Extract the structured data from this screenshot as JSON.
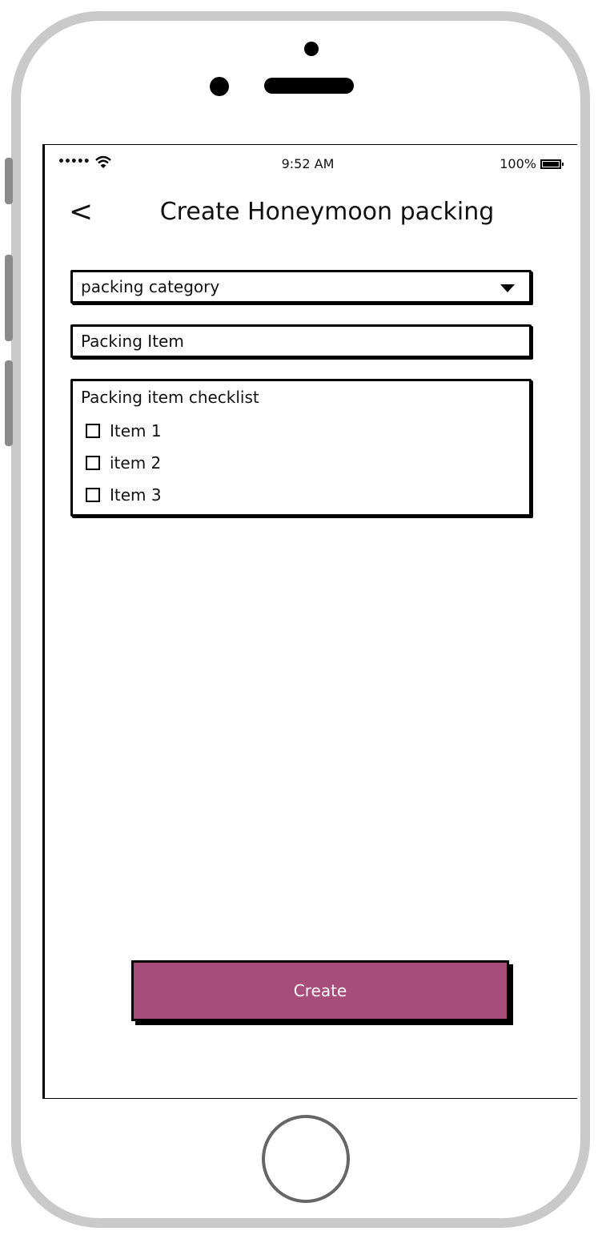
{
  "status_bar": {
    "signal": "•••••",
    "time": "9:52 AM",
    "battery": "100%"
  },
  "nav": {
    "back_glyph": "<",
    "title": "Create Honeymoon packing"
  },
  "form": {
    "category_placeholder": "packing category",
    "item_placeholder": "Packing Item",
    "checklist": {
      "title": "Packing item checklist",
      "items": [
        {
          "label": "Item 1"
        },
        {
          "label": "item 2"
        },
        {
          "label": "Item 3"
        }
      ]
    }
  },
  "actions": {
    "create_label": "Create"
  },
  "colors": {
    "primary_button": "#a74d79",
    "frame": "#c9c9c9"
  }
}
